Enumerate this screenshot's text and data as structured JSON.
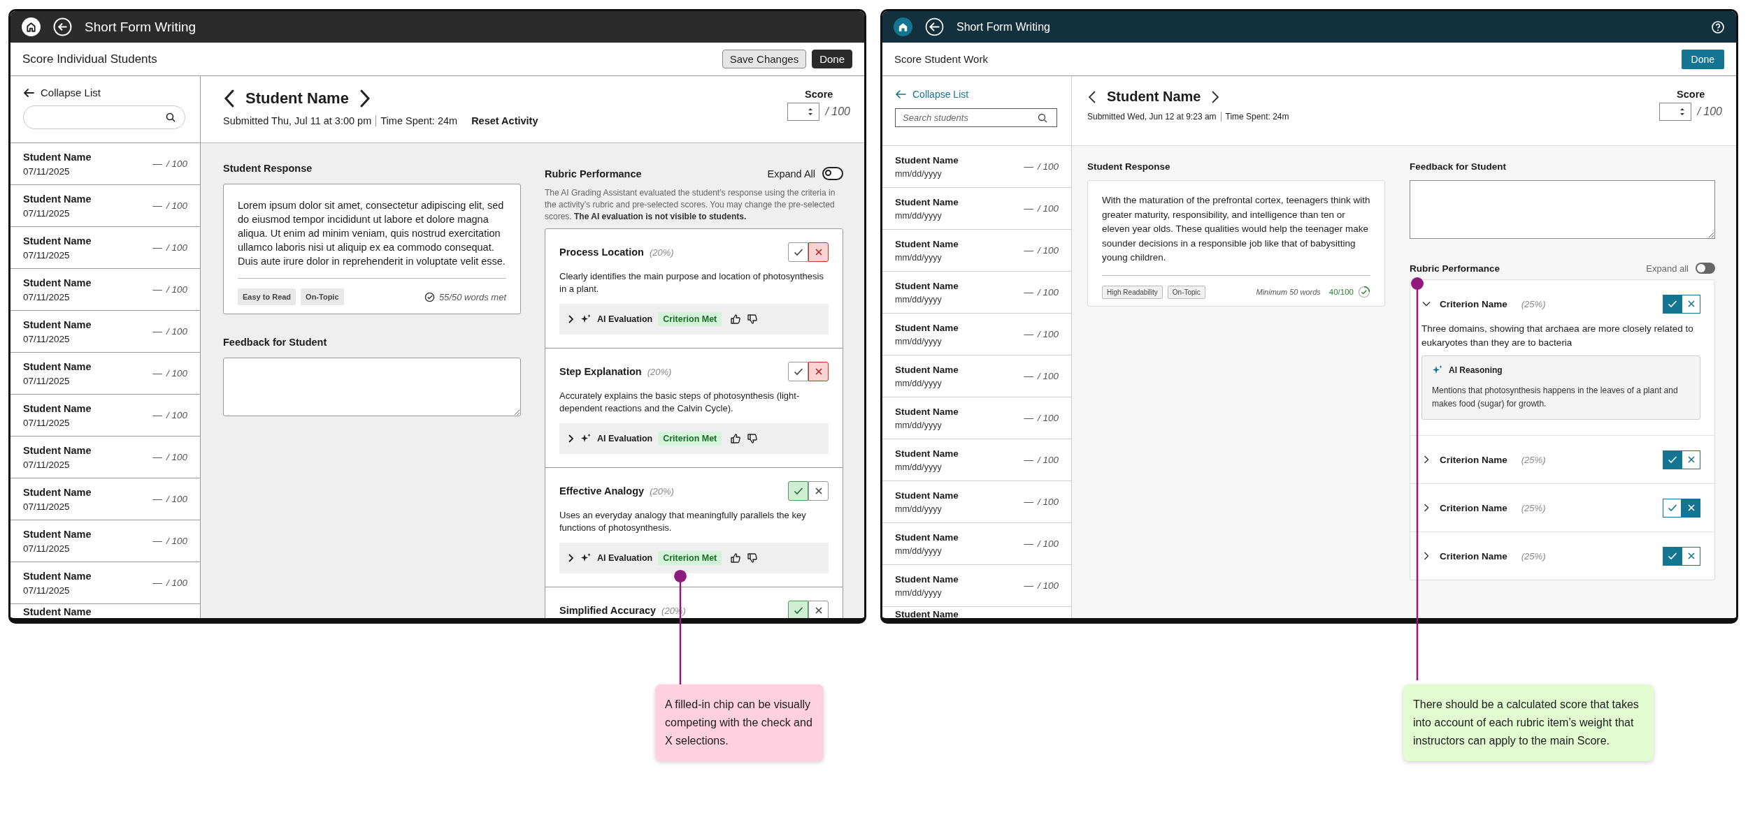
{
  "left_window": {
    "title": "Short Form Writing",
    "subheader": {
      "title": "Score Individual Students",
      "buttons": [
        {
          "label": "Save Changes",
          "kind": "secondary"
        },
        {
          "label": "Done",
          "kind": "primary"
        }
      ]
    },
    "sidebar": {
      "collapse_label": "Collapse List",
      "students": [
        {
          "name": "Student Name",
          "date": "07/11/2025",
          "score": "—",
          "out_of": "/ 100"
        },
        {
          "name": "Student Name",
          "date": "07/11/2025",
          "score": "—",
          "out_of": "/ 100"
        },
        {
          "name": "Student Name",
          "date": "07/11/2025",
          "score": "—",
          "out_of": "/ 100"
        },
        {
          "name": "Student Name",
          "date": "07/11/2025",
          "score": "—",
          "out_of": "/ 100"
        },
        {
          "name": "Student Name",
          "date": "07/11/2025",
          "score": "—",
          "out_of": "/ 100"
        },
        {
          "name": "Student Name",
          "date": "07/11/2025",
          "score": "—",
          "out_of": "/ 100"
        },
        {
          "name": "Student Name",
          "date": "07/11/2025",
          "score": "—",
          "out_of": "/ 100"
        },
        {
          "name": "Student Name",
          "date": "07/11/2025",
          "score": "—",
          "out_of": "/ 100"
        },
        {
          "name": "Student Name",
          "date": "07/11/2025",
          "score": "—",
          "out_of": "/ 100"
        },
        {
          "name": "Student Name",
          "date": "07/11/2025",
          "score": "—",
          "out_of": "/ 100"
        },
        {
          "name": "Student Name",
          "date": "07/11/2025",
          "score": "—",
          "out_of": "/ 100"
        },
        {
          "name": "Student Name"
        }
      ]
    },
    "student_header": {
      "name": "Student Name",
      "submitted": "Submitted Thu, Jul 11 at 3:00 pm",
      "time_spent": "Time Spent: 24m",
      "reset": "Reset Activity",
      "score_label": "Score",
      "score_max": "/ 100"
    },
    "response": {
      "heading": "Student Response",
      "text": "Lorem ipsum dolor sit amet, consectetur adipiscing elit, sed do eiusmod tempor incididunt ut labore et dolore magna aliqua. Ut enim ad minim veniam, quis nostrud exercitation ullamco laboris nisi ut aliquip ex ea commodo consequat. Duis aute irure dolor in reprehenderit in voluptate velit esse.",
      "tags": [
        "Easy to Read",
        "On-Topic"
      ],
      "word_count": "55/50 words met"
    },
    "feedback": {
      "heading": "Feedback for Student"
    },
    "rubric": {
      "heading": "Rubric Performance",
      "expand_label": "Expand All",
      "expand_on": false,
      "intro": "The AI Grading Assistant evaluated the student’s response using the criteria in the activity’s rubric and pre-selected scores. You may change the pre-selected scores. **The AI evaluation is not visible to students.**",
      "criteria": [
        {
          "name": "Process Location",
          "weight": "(20%)",
          "met": false,
          "description": "Clearly identifies the main purpose and location of photosynthesis in a plant.",
          "ai_label": "AI Evaluation",
          "chip": "Criterion Met"
        },
        {
          "name": "Step Explanation",
          "weight": "(20%)",
          "met": false,
          "description": "Accurately explains the basic steps of photosynthesis (light-dependent reactions and the Calvin Cycle).",
          "ai_label": "AI Evaluation",
          "chip": "Criterion Met"
        },
        {
          "name": "Effective Analogy",
          "weight": "(20%)",
          "met": true,
          "description": "Uses an everyday analogy that meaningfully parallels the key functions of photosynthesis.",
          "ai_label": "AI Evaluation",
          "chip": "Criterion Met"
        },
        {
          "name": "Simplified Accuracy",
          "weight": "(20%)",
          "met": true
        }
      ]
    }
  },
  "right_window": {
    "title": "Short Form Writing",
    "subheader": {
      "title": "Score Student Work",
      "done": "Done"
    },
    "sidebar": {
      "collapse_label": "Collapse List",
      "search": {
        "placeholder": "Search students"
      },
      "students": [
        {
          "name": "Student Name",
          "date": "mm/dd/yyyy",
          "score": "—",
          "out_of": "/ 100"
        },
        {
          "name": "Student Name",
          "date": "mm/dd/yyyy",
          "score": "—",
          "out_of": "/ 100"
        },
        {
          "name": "Student Name",
          "date": "mm/dd/yyyy",
          "score": "—",
          "out_of": "/ 100"
        },
        {
          "name": "Student Name",
          "date": "mm/dd/yyyy",
          "score": "—",
          "out_of": "/ 100"
        },
        {
          "name": "Student Name",
          "date": "mm/dd/yyyy",
          "score": "—",
          "out_of": "/ 100"
        },
        {
          "name": "Student Name",
          "date": "mm/dd/yyyy",
          "score": "—",
          "out_of": "/ 100"
        },
        {
          "name": "Student Name",
          "date": "mm/dd/yyyy",
          "score": "—",
          "out_of": "/ 100"
        },
        {
          "name": "Student Name",
          "date": "mm/dd/yyyy",
          "score": "—",
          "out_of": "/ 100"
        },
        {
          "name": "Student Name",
          "date": "mm/dd/yyyy",
          "score": "—",
          "out_of": "/ 100"
        },
        {
          "name": "Student Name",
          "date": "mm/dd/yyyy",
          "score": "—",
          "out_of": "/ 100"
        },
        {
          "name": "Student Name",
          "date": "mm/dd/yyyy",
          "score": "—",
          "out_of": "/ 100"
        },
        {
          "name": "Student Name"
        }
      ]
    },
    "student_header": {
      "name": "Student Name",
      "submitted": "Submitted  Wed, Jun 12 at 9:23 am",
      "time_spent": "Time Spent: 24m",
      "score_label": "Score",
      "score_max": "/ 100"
    },
    "response": {
      "heading": "Student Response",
      "text": "With the maturation of the prefrontal cortex, teenagers think with greater maturity, responsibility, and intelligence than ten or eleven year olds. These qualities would help the teenager make sounder decisions in a responsible job like that of babysitting young children.",
      "tags": [
        "High Readability",
        "On-Topic"
      ],
      "minimum": "Minimum 50 words",
      "count": "40/100"
    },
    "feedback": {
      "heading": "Feedback for Student"
    },
    "rubric": {
      "heading": "Rubric Performance",
      "expand_label": "Expand all",
      "expand_on": false,
      "criteria": [
        {
          "name": "Criterion Name",
          "weight": "(25%)",
          "expanded": true,
          "met": true,
          "description": "Three domains, showing that archaea are more closely related to eukaryotes than they are to bacteria",
          "reasoning_label": "AI Reasoning",
          "reasoning": "Mentions that photosynthesis happens in the leaves of a plant and makes food (sugar) for growth."
        },
        {
          "name": "Criterion Name",
          "weight": "(25%)",
          "expanded": false,
          "met": true
        },
        {
          "name": "Criterion Name",
          "weight": "(25%)",
          "expanded": false,
          "met": false
        },
        {
          "name": "Criterion Name",
          "weight": "(25%)",
          "expanded": false,
          "met": true
        }
      ]
    }
  },
  "annotations": [
    {
      "text": "A filled-in chip can be visually competing with the check and X selections.",
      "color": "#ffd0df"
    },
    {
      "text": "There should be a calculated score that takes into account of each rubric item’s weight that instructors can apply to the main Score.",
      "color": "#e2fbd1"
    }
  ]
}
